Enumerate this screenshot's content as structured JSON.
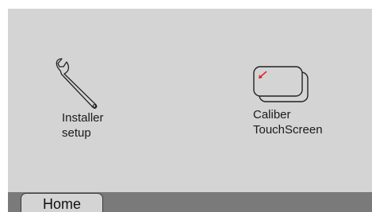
{
  "tiles": [
    {
      "label": "Installer\nsetup",
      "icon": "wrench-icon"
    },
    {
      "label": "Caliber\nTouchScreen",
      "icon": "touchscreen-icon"
    }
  ],
  "bottom_bar": {
    "home_label": "Home"
  },
  "colors": {
    "background": "#d4d4d4",
    "bar": "#7a7a7a",
    "accent": "#e0262a"
  }
}
